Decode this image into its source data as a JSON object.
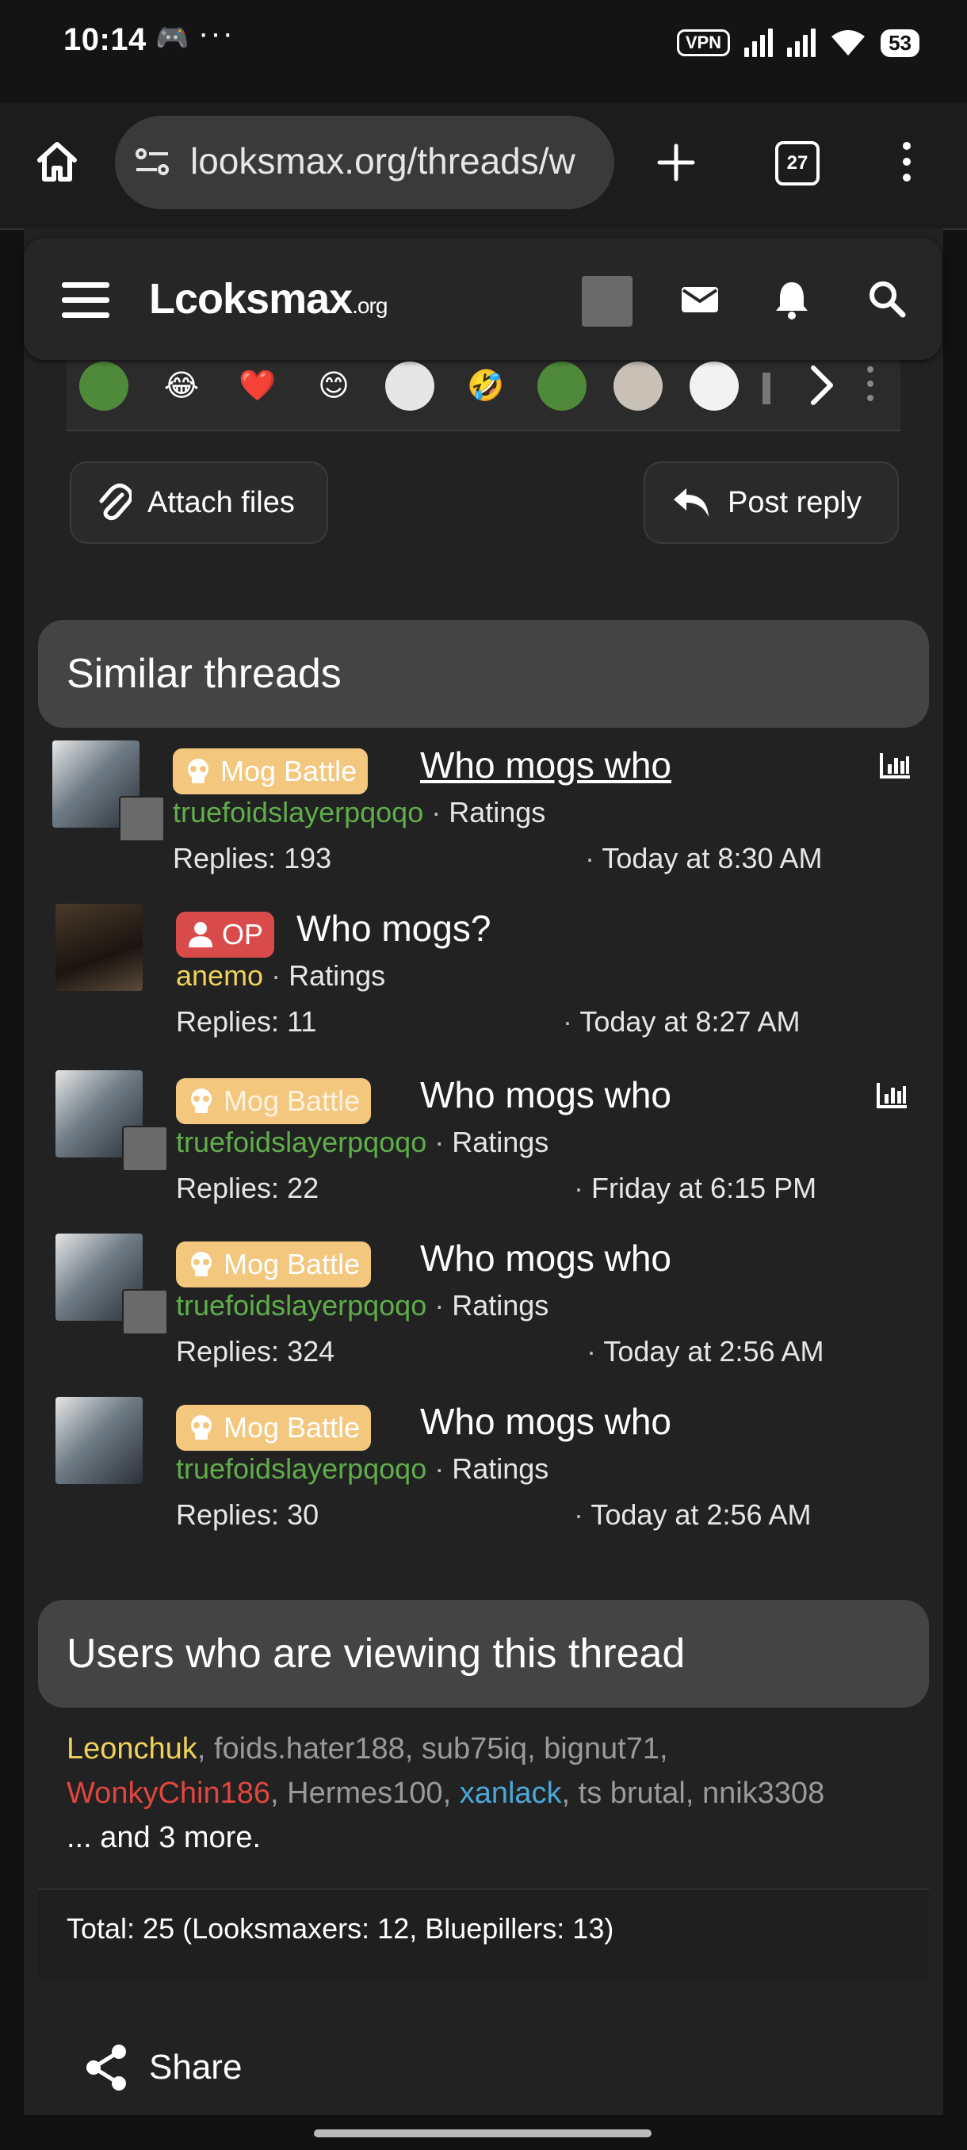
{
  "status_bar": {
    "time": "10:14",
    "vpn": "VPN",
    "battery": "53"
  },
  "browser": {
    "url": "looksmax.org/threads/w",
    "tab_count": "27"
  },
  "site": {
    "logo_main": "Lcoksmax",
    "logo_tld": ".org"
  },
  "reply_box": {
    "attach_label": "Attach files",
    "reply_label": "Post reply"
  },
  "similar": {
    "heading": "Similar threads",
    "threads": [
      {
        "prefix": "Mog Battle",
        "title": "Who mogs who",
        "author": "truefoidslayerpqoqo",
        "forum": "Ratings",
        "replies": "Replies: 193",
        "date": "Today at 8:30 AM"
      },
      {
        "prefix": "OP",
        "title": "Who mogs?",
        "author": "anemo",
        "forum": "Ratings",
        "replies": "Replies: 11",
        "date": "Today at 8:27 AM"
      },
      {
        "prefix": "Mog Battle",
        "title": "Who mogs who",
        "author": "truefoidslayerpqoqo",
        "forum": "Ratings",
        "replies": "Replies: 22",
        "date": "Friday at 6:15 PM"
      },
      {
        "prefix": "Mog Battle",
        "title": "Who mogs who",
        "author": "truefoidslayerpqoqo",
        "forum": "Ratings",
        "replies": "Replies: 324",
        "date": "Today at 2:56 AM"
      },
      {
        "prefix": "Mog Battle",
        "title": "Who mogs who",
        "author": "truefoidslayerpqoqo",
        "forum": "Ratings",
        "replies": "Replies: 30",
        "date": "Today at 2:56 AM"
      }
    ]
  },
  "viewers": {
    "heading": "Users who are viewing this thread",
    "users": [
      "Leonchuk",
      "foids.hater188",
      "sub75iq",
      "bignut71",
      "WonkyChin186",
      "Hermes100",
      "xanlack",
      "ts brutal",
      "nnik3308"
    ],
    "more": "... and 3 more.",
    "total": "Total: 25 (Looksmaxers: 12, Bluepillers: 13)"
  },
  "share_label": "Share",
  "colors": {
    "mog_prefix": "#f3c77e",
    "op_prefix": "#d94b4b",
    "green_user": "#5fae4a",
    "yellow_user": "#f0d25a",
    "red_user": "#e0463e",
    "blue_user": "#4aa8d8"
  },
  "icons": [
    "home-icon",
    "site-settings-icon",
    "plus-icon",
    "more-vert-icon",
    "menu-icon",
    "envelope-icon",
    "bell-icon",
    "search-icon",
    "paperclip-icon",
    "reply-arrow-icon",
    "skull-icon",
    "user-icon",
    "bar-chart-icon",
    "share-icon"
  ]
}
